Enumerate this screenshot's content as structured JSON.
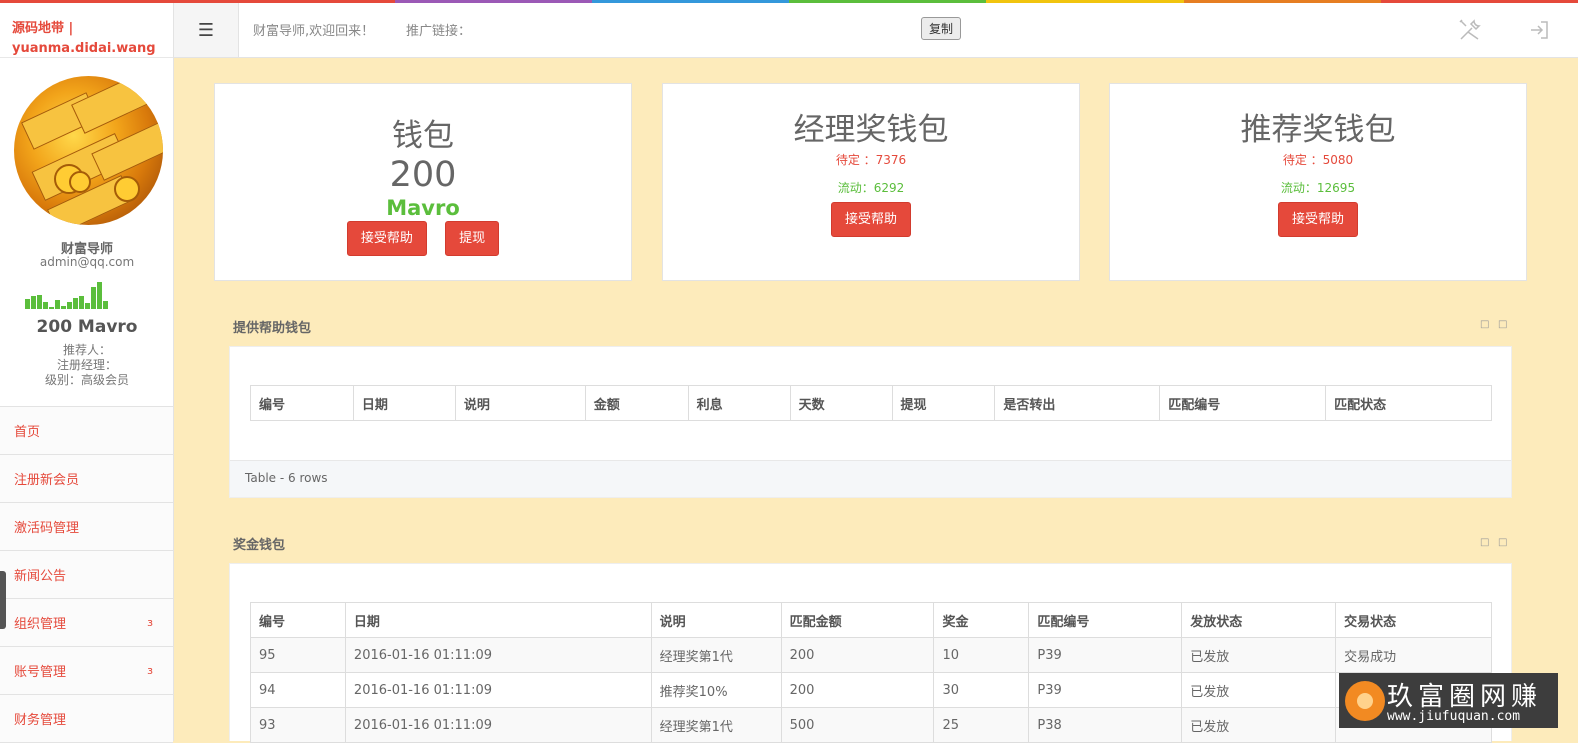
{
  "brand": {
    "line1": "源码地带 |",
    "line2": "yuanma.didai.wang"
  },
  "profile": {
    "name": "财富导师",
    "email": "admin@qq.com",
    "balance": "200 Mavro",
    "referrer": "推荐人：",
    "registrar": "注册经理：",
    "level": "级别：高级会员",
    "activity_bars": [
      10,
      13,
      14,
      7,
      2,
      9,
      3,
      7,
      11,
      13,
      6,
      22,
      27,
      8
    ]
  },
  "nav": [
    {
      "label": "首页",
      "has_children": false
    },
    {
      "label": "注册新会员",
      "has_children": false
    },
    {
      "label": "激活码管理",
      "has_children": false
    },
    {
      "label": "新闻公告",
      "has_children": false
    },
    {
      "label": "组织管理",
      "has_children": true
    },
    {
      "label": "账号管理",
      "has_children": true
    },
    {
      "label": "财务管理",
      "has_children": false
    }
  ],
  "topbar": {
    "welcome": "财富导师,欢迎回来！",
    "promo_label": "推广链接：",
    "copy_button": "复制"
  },
  "wallets": {
    "main": {
      "title": "钱包",
      "amount": "200",
      "currency": "Mavro",
      "receive_button": "接受帮助",
      "withdraw_button": "提现"
    },
    "manager": {
      "title": "经理奖钱包",
      "pending": "待定 ：7376",
      "flowing": "流动：6292",
      "receive_button": "接受帮助"
    },
    "referral": {
      "title": "推荐奖钱包",
      "pending": "待定 ：5080",
      "flowing": "流动：12695",
      "receive_button": "接受帮助"
    }
  },
  "provide_panel": {
    "title": "提供帮助钱包",
    "columns": [
      "编号",
      "日期",
      "说明",
      "金额",
      "利息",
      "天数",
      "提现",
      "是否转出",
      "匹配编号",
      "匹配状态"
    ],
    "footer": "Table - 6 rows"
  },
  "bonus_panel": {
    "title": "奖金钱包",
    "columns": [
      "编号",
      "日期",
      "说明",
      "匹配金额",
      "奖金",
      "匹配编号",
      "发放状态",
      "交易状态"
    ],
    "rows": [
      [
        "95",
        "2016-01-16 01:11:09",
        "经理奖第1代",
        "200",
        "10",
        "P39",
        "已发放",
        "交易成功"
      ],
      [
        "94",
        "2016-01-16 01:11:09",
        "推荐奖10%",
        "200",
        "30",
        "P39",
        "已发放",
        ""
      ],
      [
        "93",
        "2016-01-16 01:11:09",
        "经理奖第1代",
        "500",
        "25",
        "P38",
        "已发放",
        ""
      ]
    ]
  },
  "watermark": {
    "title": "玖富圈网赚",
    "url": "www.jiufuquan.com"
  },
  "colors": {
    "accent": "#e5493b",
    "green": "#5bbe3c",
    "background": "#fdebbb"
  }
}
